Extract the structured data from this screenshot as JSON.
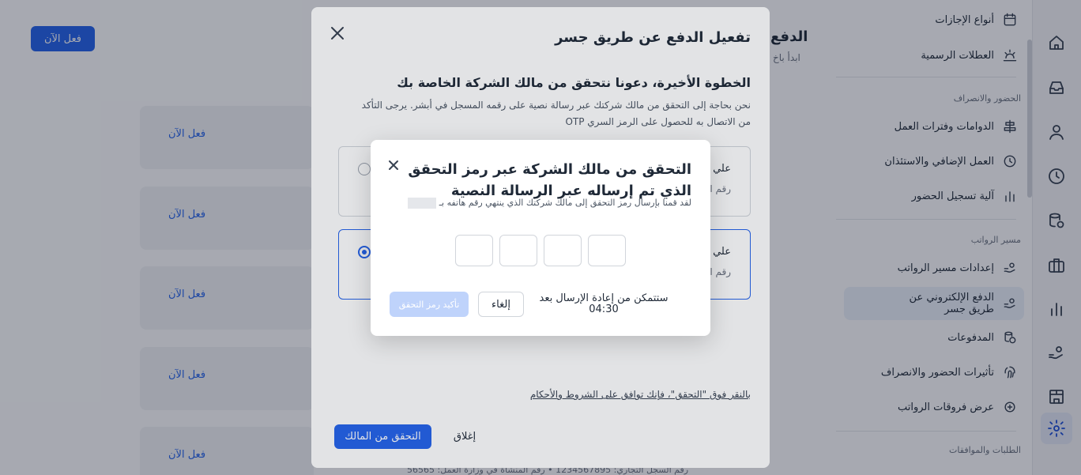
{
  "background": {
    "action_button": "فعل الآن",
    "card_action": "فعل الآن",
    "title": "الدفع",
    "subtitle": "ابدأ باخ",
    "footer": "رقم السجل التجاري: 1234567895 • رقم المنشأة في وزارة العمل: 56565"
  },
  "sidemenu": {
    "items": [
      {
        "label": "أنواع الإجازات",
        "icon": "calendar-icon"
      },
      {
        "label": "العطلات الرسمية",
        "icon": "holiday-icon"
      },
      {
        "label": "الدوامات وفترات العمل",
        "icon": "shifts-icon"
      },
      {
        "label": "العمل الإضافي والاستئذان",
        "icon": "overtime-clock-icon"
      },
      {
        "label": "آلية تسجيل الحضور",
        "icon": "chart-bars-icon"
      },
      {
        "label": "إعدادات مسير الرواتب",
        "icon": "payroll-settings-icon"
      },
      {
        "label": "الدفع الإلكتروني عن طريق جسر",
        "icon": "payment-icon"
      },
      {
        "label": "المدفوعات",
        "icon": "coins-icon"
      },
      {
        "label": "تأثيرات الحضور والانصراف",
        "icon": "fingerprint-icon"
      },
      {
        "label": "عرض فروقات الرواتب",
        "icon": "differences-icon"
      }
    ],
    "sections": {
      "attendance": "الحضور والانصراف",
      "payroll": "مسير الرواتب",
      "requests": "الطلبات والموافقات"
    }
  },
  "rail": {
    "icons": [
      "home-icon",
      "inbox-icon",
      "user-icon",
      "clock-icon",
      "database-icon",
      "briefcase-icon",
      "bar-chart-icon",
      "hand-coin-icon",
      "building-icon",
      "settings-icon"
    ],
    "active": "settings-icon"
  },
  "modal": {
    "title": "تفعيل الدفع عن طريق جسر",
    "step_title": "الخطوة الأخيرة، دعونا نتحقق من مالك الشركة الخاصة بك",
    "step_desc": "نحن بحاجة إلى التحقق من مالك شركتك عبر رسالة نصية على رقمه المسجل في أبشر. يرجى التأكد من الاتصال به للحصول على الرمز السري OTP",
    "option1_title": "علي",
    "option1_sub": "رقم ا",
    "option2_title": "علي",
    "option2_sub": "رقم ا",
    "terms": "بالنقر فوق \"التحقق\"، فإنك توافق على الشروط والأحكام",
    "primary_button": "التحقق من المالك",
    "close_button": "إغلاق"
  },
  "otp": {
    "title": "التحقق من مالك الشركة عبر رمز التحقق الذي تم إرساله عبر الرسالة النصية",
    "desc": "لقد قمنا بإرسال رمز التحقق إلى مالك شركتك الذي ينتهي رقم هاتفه بـ",
    "timer_label": "ستتمكن من إعادة الإرسال بعد",
    "timer_value": "04:30",
    "cancel": "إلغاء",
    "confirm": "تأكيد رمز التحقق"
  }
}
